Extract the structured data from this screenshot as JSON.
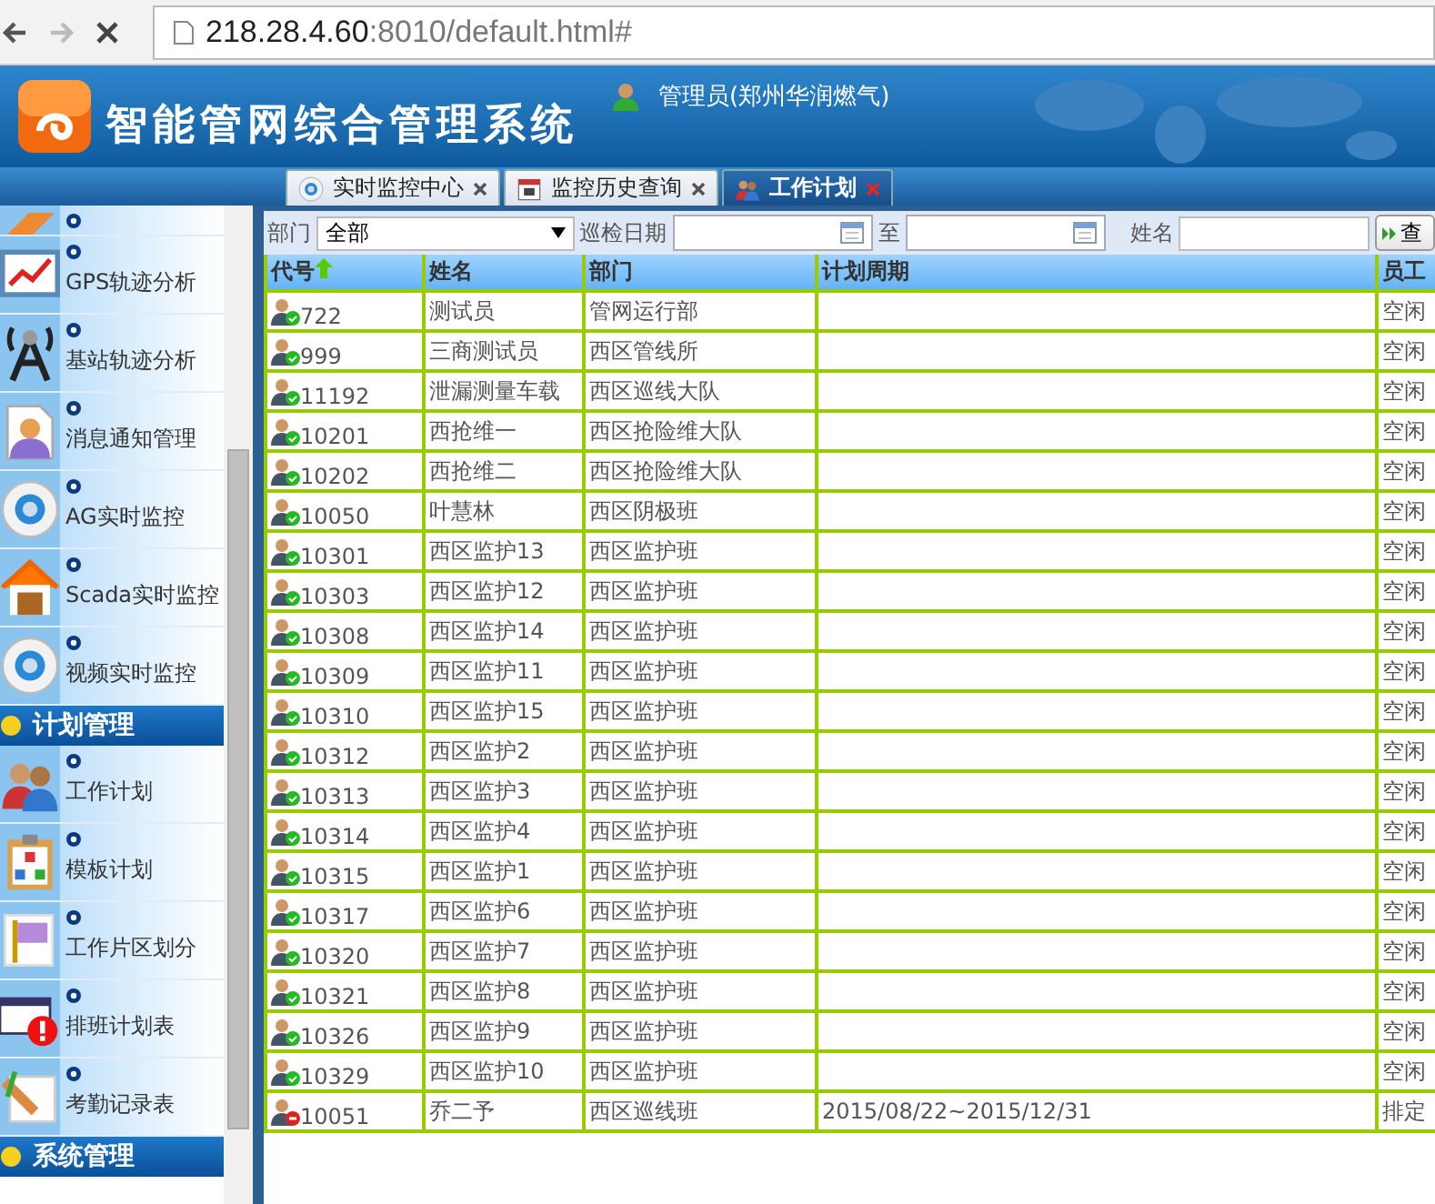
{
  "browser": {
    "url_host": "218.28.4.60",
    "url_rest": ":8010/default.html#"
  },
  "header": {
    "title": "智能管网综合管理系统",
    "user": "管理员(郑州华润燃气)"
  },
  "tabs": [
    {
      "label": "实时监控中心",
      "selected": false
    },
    {
      "label": "监控历史查询",
      "selected": false
    },
    {
      "label": "工作计划",
      "selected": true
    }
  ],
  "sidebar": {
    "items": [
      {
        "kind": "partial"
      },
      {
        "kind": "item",
        "label": "GPS轨迹分析"
      },
      {
        "kind": "item",
        "label": "基站轨迹分析"
      },
      {
        "kind": "item",
        "label": "消息通知管理"
      },
      {
        "kind": "item",
        "label": "AG实时监控"
      },
      {
        "kind": "item",
        "label": "Scada实时监控"
      },
      {
        "kind": "item",
        "label": "视频实时监控"
      },
      {
        "kind": "group",
        "label": "计划管理"
      },
      {
        "kind": "item",
        "label": "工作计划"
      },
      {
        "kind": "item",
        "label": "模板计划"
      },
      {
        "kind": "item",
        "label": "工作片区划分"
      },
      {
        "kind": "item",
        "label": "排班计划表"
      },
      {
        "kind": "item",
        "label": "考勤记录表"
      },
      {
        "kind": "group",
        "label": "系统管理"
      }
    ]
  },
  "filters": {
    "dept_label": "部门",
    "dept_value": "全部",
    "date_label": "巡检日期",
    "to_label": "至",
    "name_label": "姓名",
    "search_button": "查"
  },
  "table": {
    "columns": [
      {
        "label": "代号",
        "sorted": true
      },
      {
        "label": "姓名",
        "sorted": false
      },
      {
        "label": "部门",
        "sorted": false
      },
      {
        "label": "计划周期",
        "sorted": false
      },
      {
        "label": "员工",
        "sorted": false
      }
    ],
    "rows": [
      {
        "available": true,
        "cells": [
          "722",
          "测试员",
          "管网运行部",
          "",
          "空闲"
        ]
      },
      {
        "available": true,
        "cells": [
          "999",
          "三商测试员",
          "西区管线所",
          "",
          "空闲"
        ]
      },
      {
        "available": true,
        "cells": [
          "11192",
          "泄漏测量车载",
          "西区巡线大队",
          "",
          "空闲"
        ]
      },
      {
        "available": true,
        "cells": [
          "10201",
          "西抢维一",
          "西区抢险维大队",
          "",
          "空闲"
        ]
      },
      {
        "available": true,
        "cells": [
          "10202",
          "西抢维二",
          "西区抢险维大队",
          "",
          "空闲"
        ]
      },
      {
        "available": true,
        "cells": [
          "10050",
          "叶慧林",
          "西区阴极班",
          "",
          "空闲"
        ]
      },
      {
        "available": true,
        "cells": [
          "10301",
          "西区监护13",
          "西区监护班",
          "",
          "空闲"
        ]
      },
      {
        "available": true,
        "cells": [
          "10303",
          "西区监护12",
          "西区监护班",
          "",
          "空闲"
        ]
      },
      {
        "available": true,
        "cells": [
          "10308",
          "西区监护14",
          "西区监护班",
          "",
          "空闲"
        ]
      },
      {
        "available": true,
        "cells": [
          "10309",
          "西区监护11",
          "西区监护班",
          "",
          "空闲"
        ]
      },
      {
        "available": true,
        "cells": [
          "10310",
          "西区监护15",
          "西区监护班",
          "",
          "空闲"
        ]
      },
      {
        "available": true,
        "cells": [
          "10312",
          "西区监护2",
          "西区监护班",
          "",
          "空闲"
        ]
      },
      {
        "available": true,
        "cells": [
          "10313",
          "西区监护3",
          "西区监护班",
          "",
          "空闲"
        ]
      },
      {
        "available": true,
        "cells": [
          "10314",
          "西区监护4",
          "西区监护班",
          "",
          "空闲"
        ]
      },
      {
        "available": true,
        "cells": [
          "10315",
          "西区监护1",
          "西区监护班",
          "",
          "空闲"
        ]
      },
      {
        "available": true,
        "cells": [
          "10317",
          "西区监护6",
          "西区监护班",
          "",
          "空闲"
        ]
      },
      {
        "available": true,
        "cells": [
          "10320",
          "西区监护7",
          "西区监护班",
          "",
          "空闲"
        ]
      },
      {
        "available": true,
        "cells": [
          "10321",
          "西区监护8",
          "西区监护班",
          "",
          "空闲"
        ]
      },
      {
        "available": true,
        "cells": [
          "10326",
          "西区监护9",
          "西区监护班",
          "",
          "空闲"
        ]
      },
      {
        "available": true,
        "cells": [
          "10329",
          "西区监护10",
          "西区监护班",
          "",
          "空闲"
        ]
      },
      {
        "available": false,
        "cells": [
          "10051",
          "乔二予",
          "西区巡线班",
          "2015/08/22~2015/12/31",
          "排定"
        ]
      }
    ]
  }
}
